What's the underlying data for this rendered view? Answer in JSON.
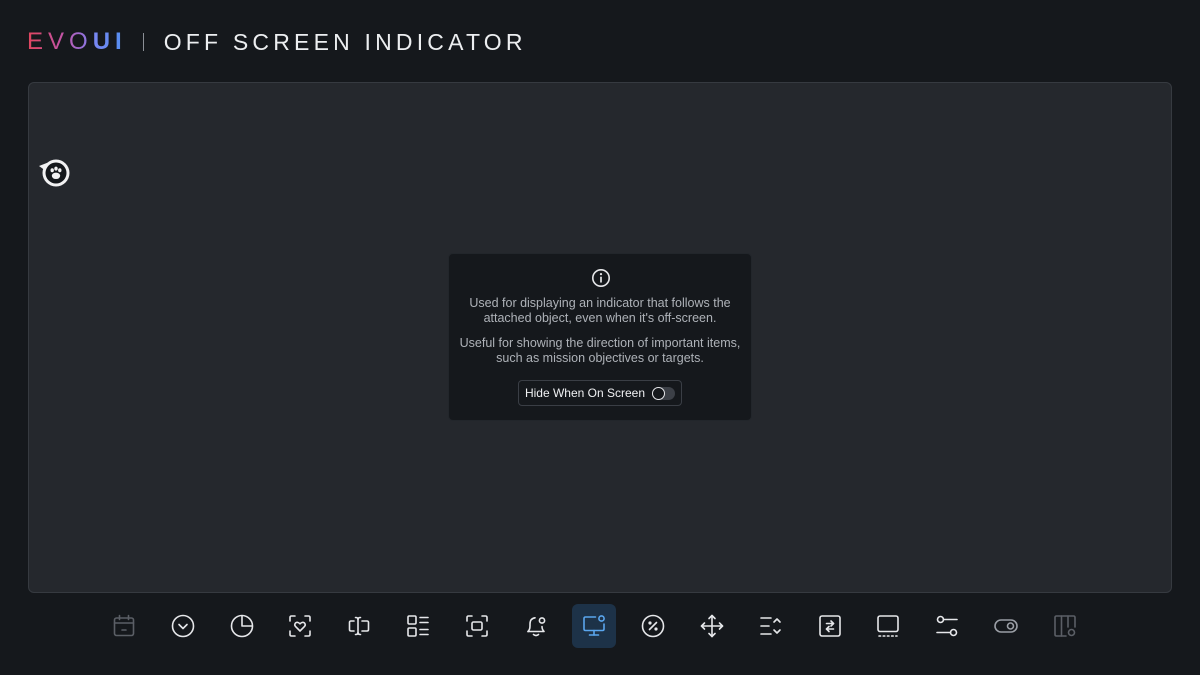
{
  "app": {
    "brand_evo": "EVO",
    "brand_ui": "UI",
    "page_title": "OFF SCREEN INDICATOR"
  },
  "info_card": {
    "description_1": "Used for displaying an indicator that follows the attached object, even when it's off-screen.",
    "description_2": "Useful for showing the direction of important items, such as mission objectives or targets.",
    "toggle_label": "Hide When On Screen",
    "toggle_on": false
  },
  "indicator": {
    "icon": "paw-icon",
    "direction": "left"
  },
  "toolbar": {
    "active_index": 8,
    "items": [
      {
        "name": "calendar-icon",
        "disabled": true
      },
      {
        "name": "chevron-down-circle-icon",
        "disabled": false
      },
      {
        "name": "pie-chart-icon",
        "disabled": false
      },
      {
        "name": "heart-frame-icon",
        "disabled": false
      },
      {
        "name": "text-cursor-icon",
        "disabled": false
      },
      {
        "name": "list-grid-icon",
        "disabled": false
      },
      {
        "name": "focus-frame-icon",
        "disabled": false
      },
      {
        "name": "bell-icon",
        "disabled": false
      },
      {
        "name": "monitor-indicator-icon",
        "disabled": false
      },
      {
        "name": "percent-circle-icon",
        "disabled": false
      },
      {
        "name": "move-arrows-icon",
        "disabled": false
      },
      {
        "name": "list-sort-icon",
        "disabled": false
      },
      {
        "name": "swap-arrows-icon",
        "disabled": false
      },
      {
        "name": "tooltip-screen-icon",
        "disabled": false
      },
      {
        "name": "sliders-icon",
        "disabled": false
      },
      {
        "name": "toggle-icon",
        "disabled": false
      },
      {
        "name": "layout-settings-icon",
        "disabled": true
      }
    ]
  },
  "colors": {
    "background": "#15181c",
    "panel": "#25282d",
    "active_tool_bg": "#1d3248",
    "active_tool_icon": "#5aa6ee",
    "icon": "#e6e7ea",
    "icon_disabled": "#5b5f66"
  }
}
